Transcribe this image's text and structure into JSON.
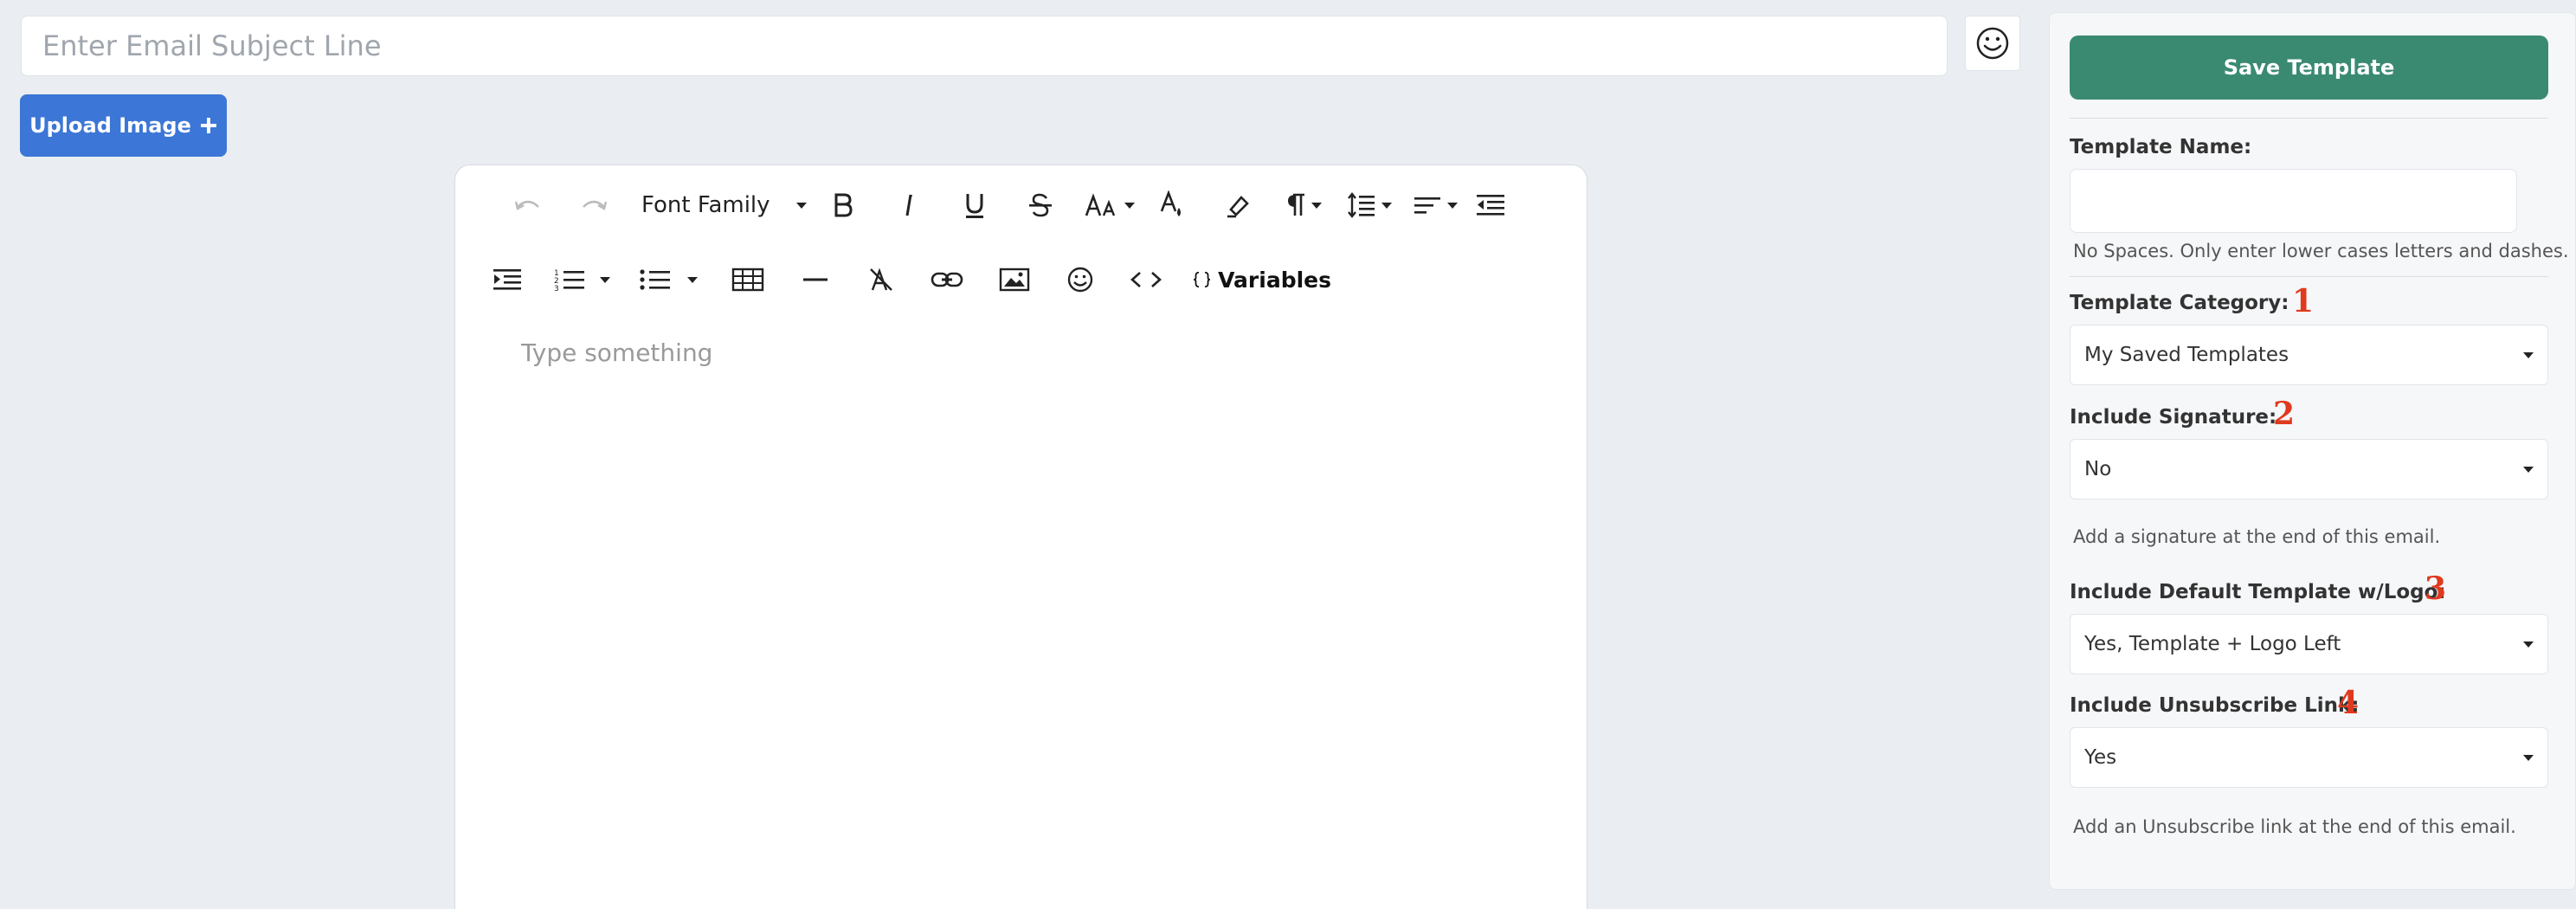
{
  "subject": {
    "placeholder": "Enter Email Subject Line",
    "value": ""
  },
  "emoji_button": {
    "icon": "smiley-icon"
  },
  "upload": {
    "label": "Upload Image",
    "icon": "plus-icon"
  },
  "editor": {
    "toolbar": {
      "font_family_label": "Font Family",
      "variables_label": "Variables"
    },
    "placeholder": "Type something"
  },
  "panel": {
    "save_label": "Save Template",
    "template_name": {
      "label": "Template Name:",
      "value": "",
      "help": "No Spaces. Only enter lower cases letters and dashes."
    },
    "template_category": {
      "label": "Template Category:",
      "marker": "1",
      "value": "My Saved Templates"
    },
    "include_signature": {
      "label": "Include Signature:",
      "marker": "2",
      "value": "No",
      "help": "Add a signature at the end of this email."
    },
    "include_default_template": {
      "label": "Include Default Template w/Logo:",
      "marker": "3",
      "value": "Yes, Template + Logo Left"
    },
    "include_unsubscribe": {
      "label": "Include Unsubscribe Link:",
      "marker": "4",
      "value": "Yes",
      "help": "Add an Unsubscribe link at the end of this email."
    }
  },
  "colors": {
    "primary_blue": "#3c76d6",
    "save_green": "#3a8a72",
    "marker_red": "#e03a1e",
    "background": "#eaedf1"
  }
}
